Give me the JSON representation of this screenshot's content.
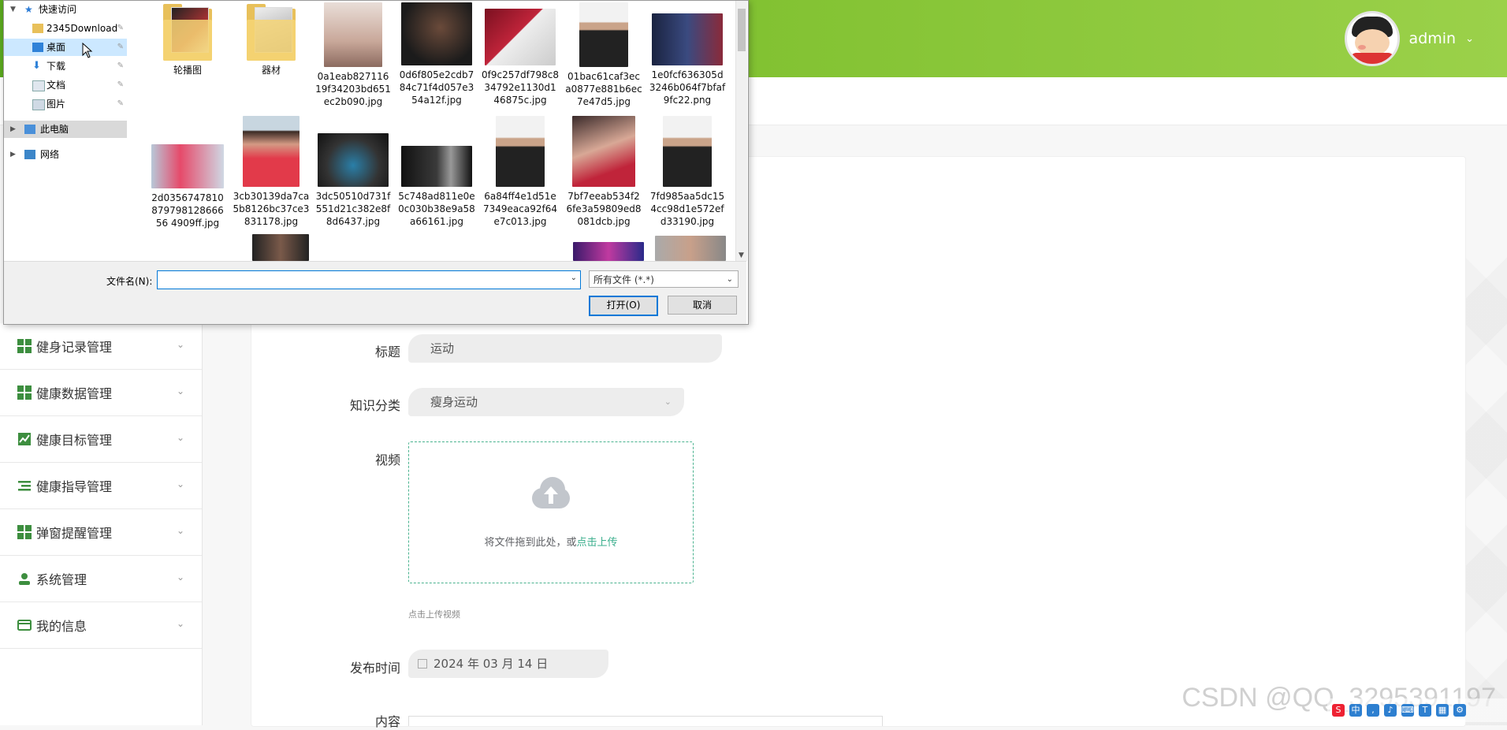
{
  "header": {
    "username": "admin",
    "caret": "⌄"
  },
  "sidebar": {
    "items": [
      {
        "label": "健身记录管理",
        "icon": "grid-icon"
      },
      {
        "label": "健康数据管理",
        "icon": "grid-icon"
      },
      {
        "label": "健康目标管理",
        "icon": "chart-icon"
      },
      {
        "label": "健康指导管理",
        "icon": "list-icon"
      },
      {
        "label": "弹窗提醒管理",
        "icon": "grid-icon"
      },
      {
        "label": "系统管理",
        "icon": "user-icon"
      },
      {
        "label": "我的信息",
        "icon": "card-icon"
      }
    ]
  },
  "form": {
    "title_label": "标题",
    "title_value": "运动",
    "category_label": "知识分类",
    "category_value": "瘦身运动",
    "video_label": "视频",
    "upload_text": "将文件拖到此处，或",
    "upload_link": "点击上传",
    "upload_tip": "点击上传视频",
    "date_label": "发布时间",
    "date_value": "2024 年 03 月 14 日",
    "content_label": "内容"
  },
  "watermark": "CSDN @QQ_3295391197",
  "dialog": {
    "nav": [
      {
        "label": "快速访问",
        "icon": "star-icon"
      },
      {
        "label": "2345Download",
        "icon": "folder-icon"
      },
      {
        "label": "桌面",
        "icon": "desktop-icon"
      },
      {
        "label": "下载",
        "icon": "download-icon"
      },
      {
        "label": "文档",
        "icon": "document-icon"
      },
      {
        "label": "图片",
        "icon": "picture-icon"
      },
      {
        "label": "此电脑",
        "icon": "computer-icon"
      },
      {
        "label": "网络",
        "icon": "network-icon"
      }
    ],
    "files": [
      {
        "name": "轮播图"
      },
      {
        "name": "器材"
      },
      {
        "name": "0a1eab82711619f34203bd651ec2b090.jpg"
      },
      {
        "name": "0d6f805e2cdb784c71f4d057e354a12f.jpg"
      },
      {
        "name": "0f9c257df798c834792e1130d146875c.jpg"
      },
      {
        "name": "01bac61caf3eca0877e881b6ec7e47d5.jpg"
      },
      {
        "name": "1e0fcf636305d3246b064f7bfaf9fc22.png"
      },
      {
        "name": "2d035674781087979812866656 4909ff.jpg"
      },
      {
        "name": "3cb30139da7ca5b8126bc37ce3831178.jpg"
      },
      {
        "name": "3dc50510d731f551d21c382e8f8d6437.jpg"
      },
      {
        "name": "5c748ad811e0e0c030b38e9a58a66161.jpg"
      },
      {
        "name": "6a84ff4e1d51e7349eaca92f64e7c013.jpg"
      },
      {
        "name": "7bf7eeab534f26fe3a59809ed8081dcb.jpg"
      },
      {
        "name": "7fd985aa5dc154cc98d1e572efd33190.jpg"
      }
    ],
    "filename_label": "文件名(N):",
    "filename_value": "",
    "filetype_value": "所有文件 (*.*)",
    "open_label": "打开(O)",
    "cancel_label": "取消"
  },
  "colors": {
    "header_green": "#82c232",
    "menu_icon_green": "#3d8e3f",
    "upload_border": "#4ab38f",
    "dialog_focus": "#0078d7"
  }
}
